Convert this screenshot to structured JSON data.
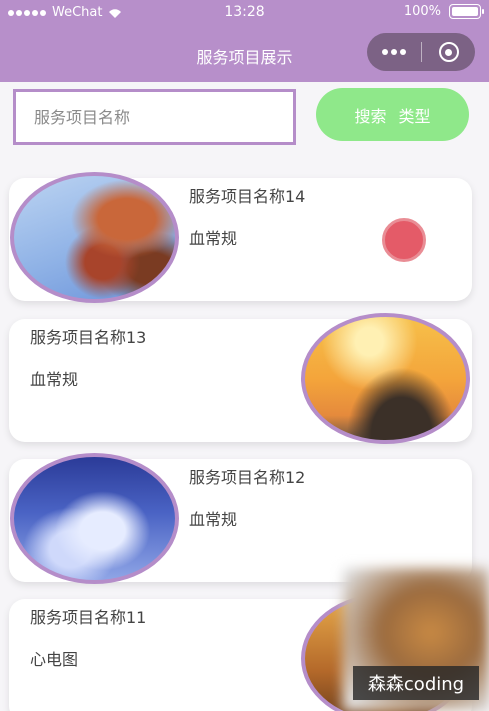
{
  "status_bar": {
    "carrier": "WeChat",
    "time": "13:28",
    "battery": "100%",
    "battery_level": 1.0
  },
  "nav": {
    "title": "服务项目展示"
  },
  "search": {
    "placeholder": "服务项目名称",
    "value": "",
    "button_label_1": "搜索",
    "button_label_2": "类型"
  },
  "items": [
    {
      "title": "服务项目名称14",
      "type": "血常规",
      "image": "autumn-leaves-sky"
    },
    {
      "title": "服务项目名称13",
      "type": "血常规",
      "image": "sunset-rocks"
    },
    {
      "title": "服务项目名称12",
      "type": "血常规",
      "image": "blue-sky-clouds"
    },
    {
      "title": "服务项目名称11",
      "type": "心电图",
      "image": "autumn-tree"
    }
  ],
  "watermark": "森森coding",
  "colors": {
    "nav_bg": "#b78fca",
    "accent_border": "#b58dc9",
    "search_button": "#8fe88a",
    "record_dot": "#e45b68"
  }
}
